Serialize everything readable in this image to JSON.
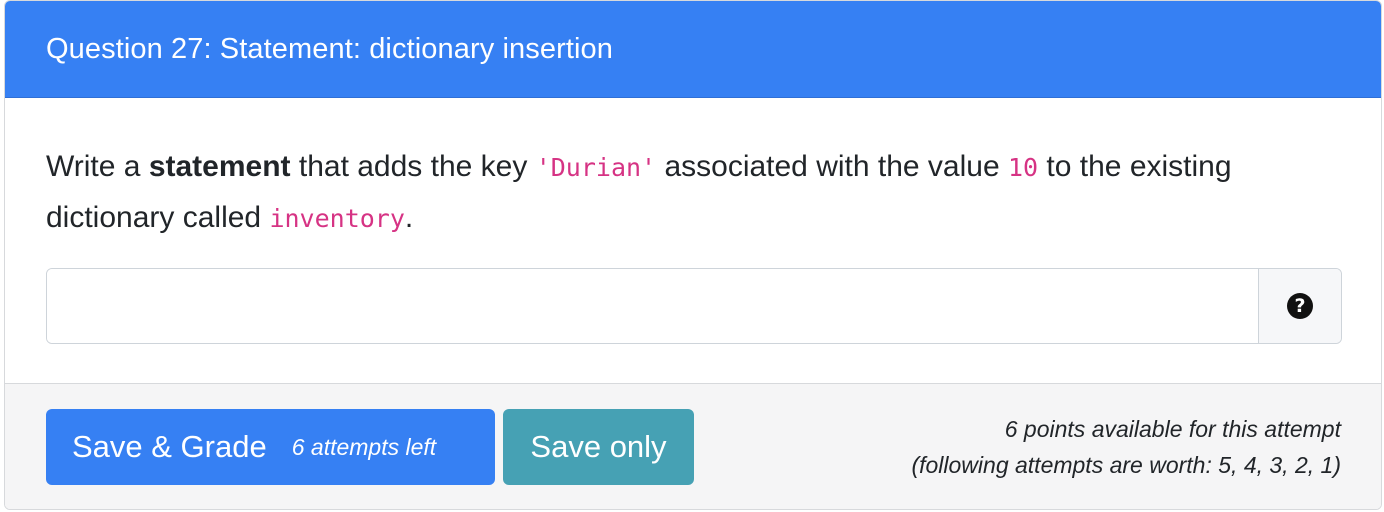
{
  "header": {
    "title": "Question 27: Statement: dictionary insertion"
  },
  "prompt": {
    "part1": "Write a ",
    "bold": "statement",
    "part2": " that adds the key ",
    "code_key": "'Durian'",
    "part3": " associated with the value ",
    "code_value": "10",
    "part4": " to the existing dictionary called ",
    "code_dict": "inventory",
    "part5": "."
  },
  "answer": {
    "value": "",
    "placeholder": ""
  },
  "icons": {
    "help": "question-circle-icon"
  },
  "footer": {
    "grade_label": "Save & Grade",
    "attempts_left": "6 attempts left",
    "save_only_label": "Save only",
    "points_line1": "6 points available for this attempt",
    "points_line2": "(following attempts are worth: 5, 4, 3, 2, 1)"
  },
  "colors": {
    "header_bg": "#3680f3",
    "grade_button": "#3680f3",
    "save_button": "#46a1b4",
    "code_text": "#d63384"
  }
}
